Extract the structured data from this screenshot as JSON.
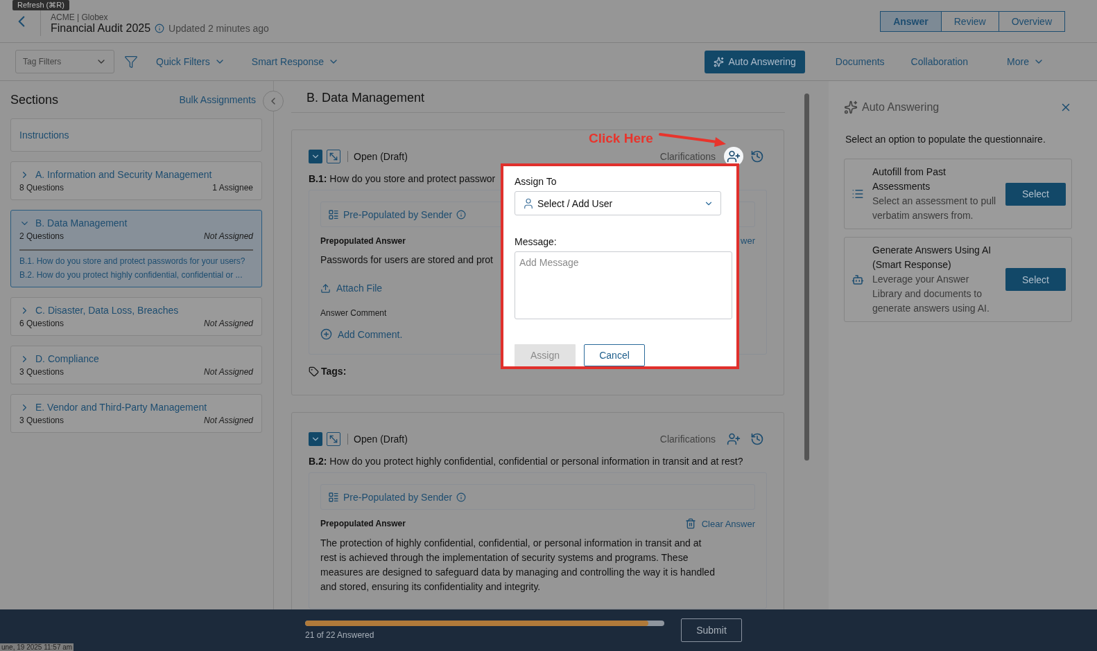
{
  "tooltip": "Refresh (⌘R)",
  "header": {
    "breadcrumb": "ACME | Globex",
    "title": "Financial Audit 2025",
    "updated": "Updated 2 minutes ago"
  },
  "view_tabs": [
    {
      "label": "Answer",
      "selected": true
    },
    {
      "label": "Review",
      "selected": false
    },
    {
      "label": "Overview",
      "selected": false
    }
  ],
  "toolbar": {
    "tag_filter": {
      "placeholder": "Tag Filters"
    },
    "quick_filters": "Quick Filters",
    "smart_response": "Smart Response",
    "auto_answering": "Auto Answering",
    "links": [
      "Documents",
      "Collaboration"
    ],
    "more": "More"
  },
  "sidebar": {
    "title": "Sections",
    "bulk": "Bulk Assignments",
    "instructions": "Instructions",
    "sections": [
      {
        "title": "A. Information and Security Management",
        "count": "8 Questions",
        "assignment": "1 Assignee",
        "assigned": true,
        "expanded": false,
        "selected": false
      },
      {
        "title": "B. Data Management",
        "count": "2 Questions",
        "assignment": "Not Assigned",
        "assigned": false,
        "expanded": true,
        "selected": true,
        "questions": [
          "B.1. How do you store and protect passwords for your users?",
          "B.2. How do you protect highly confidential, confidential or ..."
        ]
      },
      {
        "title": "C. Disaster, Data Loss, Breaches",
        "count": "6 Questions",
        "assignment": "Not Assigned",
        "assigned": false,
        "expanded": false,
        "selected": false
      },
      {
        "title": "D. Compliance",
        "count": "3 Questions",
        "assignment": "Not Assigned",
        "assigned": false,
        "expanded": false,
        "selected": false
      },
      {
        "title": "E. Vendor and Third-Party Management",
        "count": "3 Questions",
        "assignment": "Not Assigned",
        "assigned": false,
        "expanded": false,
        "selected": false
      }
    ]
  },
  "main": {
    "heading": "B. Data Management",
    "questions": [
      {
        "status": "Open (Draft)",
        "clarifications": "Clarifications",
        "highlighted": true,
        "number": "B.1:",
        "text": "How do you store and protect passwor",
        "source": "Pre-Populated by Sender",
        "answer_label": "Prepopulated Answer",
        "clear": "wer",
        "answer": "Passwords for users are stored and prot",
        "attach": "Attach File",
        "comment_label": "Answer Comment",
        "add_comment": "Add Comment.",
        "tags": "Tags:"
      },
      {
        "status": "Open (Draft)",
        "clarifications": "Clarifications",
        "highlighted": false,
        "number": "B.2:",
        "text": "How do you protect highly confidential, confidential or personal information in transit and at rest?",
        "source": "Pre-Populated by Sender",
        "answer_label": "Prepopulated Answer",
        "clear": "Clear Answer",
        "answer": "The protection of highly confidential, confidential, or personal information in transit and at rest is achieved through the implementation of security systems and programs. These measures are designed to safeguard data by managing and controlling the way it is handled and stored, ensuring its confidentiality and integrity."
      }
    ]
  },
  "auto_panel": {
    "title": "Auto Answering",
    "intro": "Select an option to populate the questionnaire.",
    "options": [
      {
        "kind": "list",
        "title": "Autofill from Past Assessments",
        "description": "Select an assessment to pull verbatim answers from.",
        "button": "Select"
      },
      {
        "kind": "robot",
        "title": "Generate Answers Using AI (Smart Response)",
        "description": "Leverage your Answer Library and documents to generate answers using AI.",
        "button": "Select"
      }
    ]
  },
  "dialog": {
    "assign_label": "Assign To",
    "user_select": {
      "placeholder": "Select / Add User"
    },
    "message_label": "Message:",
    "message": {
      "placeholder": "Add Message"
    },
    "assign": {
      "label": "Assign",
      "disabled": true
    },
    "cancel": "Cancel"
  },
  "annotation": "Click Here",
  "footer": {
    "level": 0.955,
    "progress": "21 of 22 Answered",
    "submit": "Submit",
    "timestamp": "une, 19 2025 11:57 am"
  }
}
